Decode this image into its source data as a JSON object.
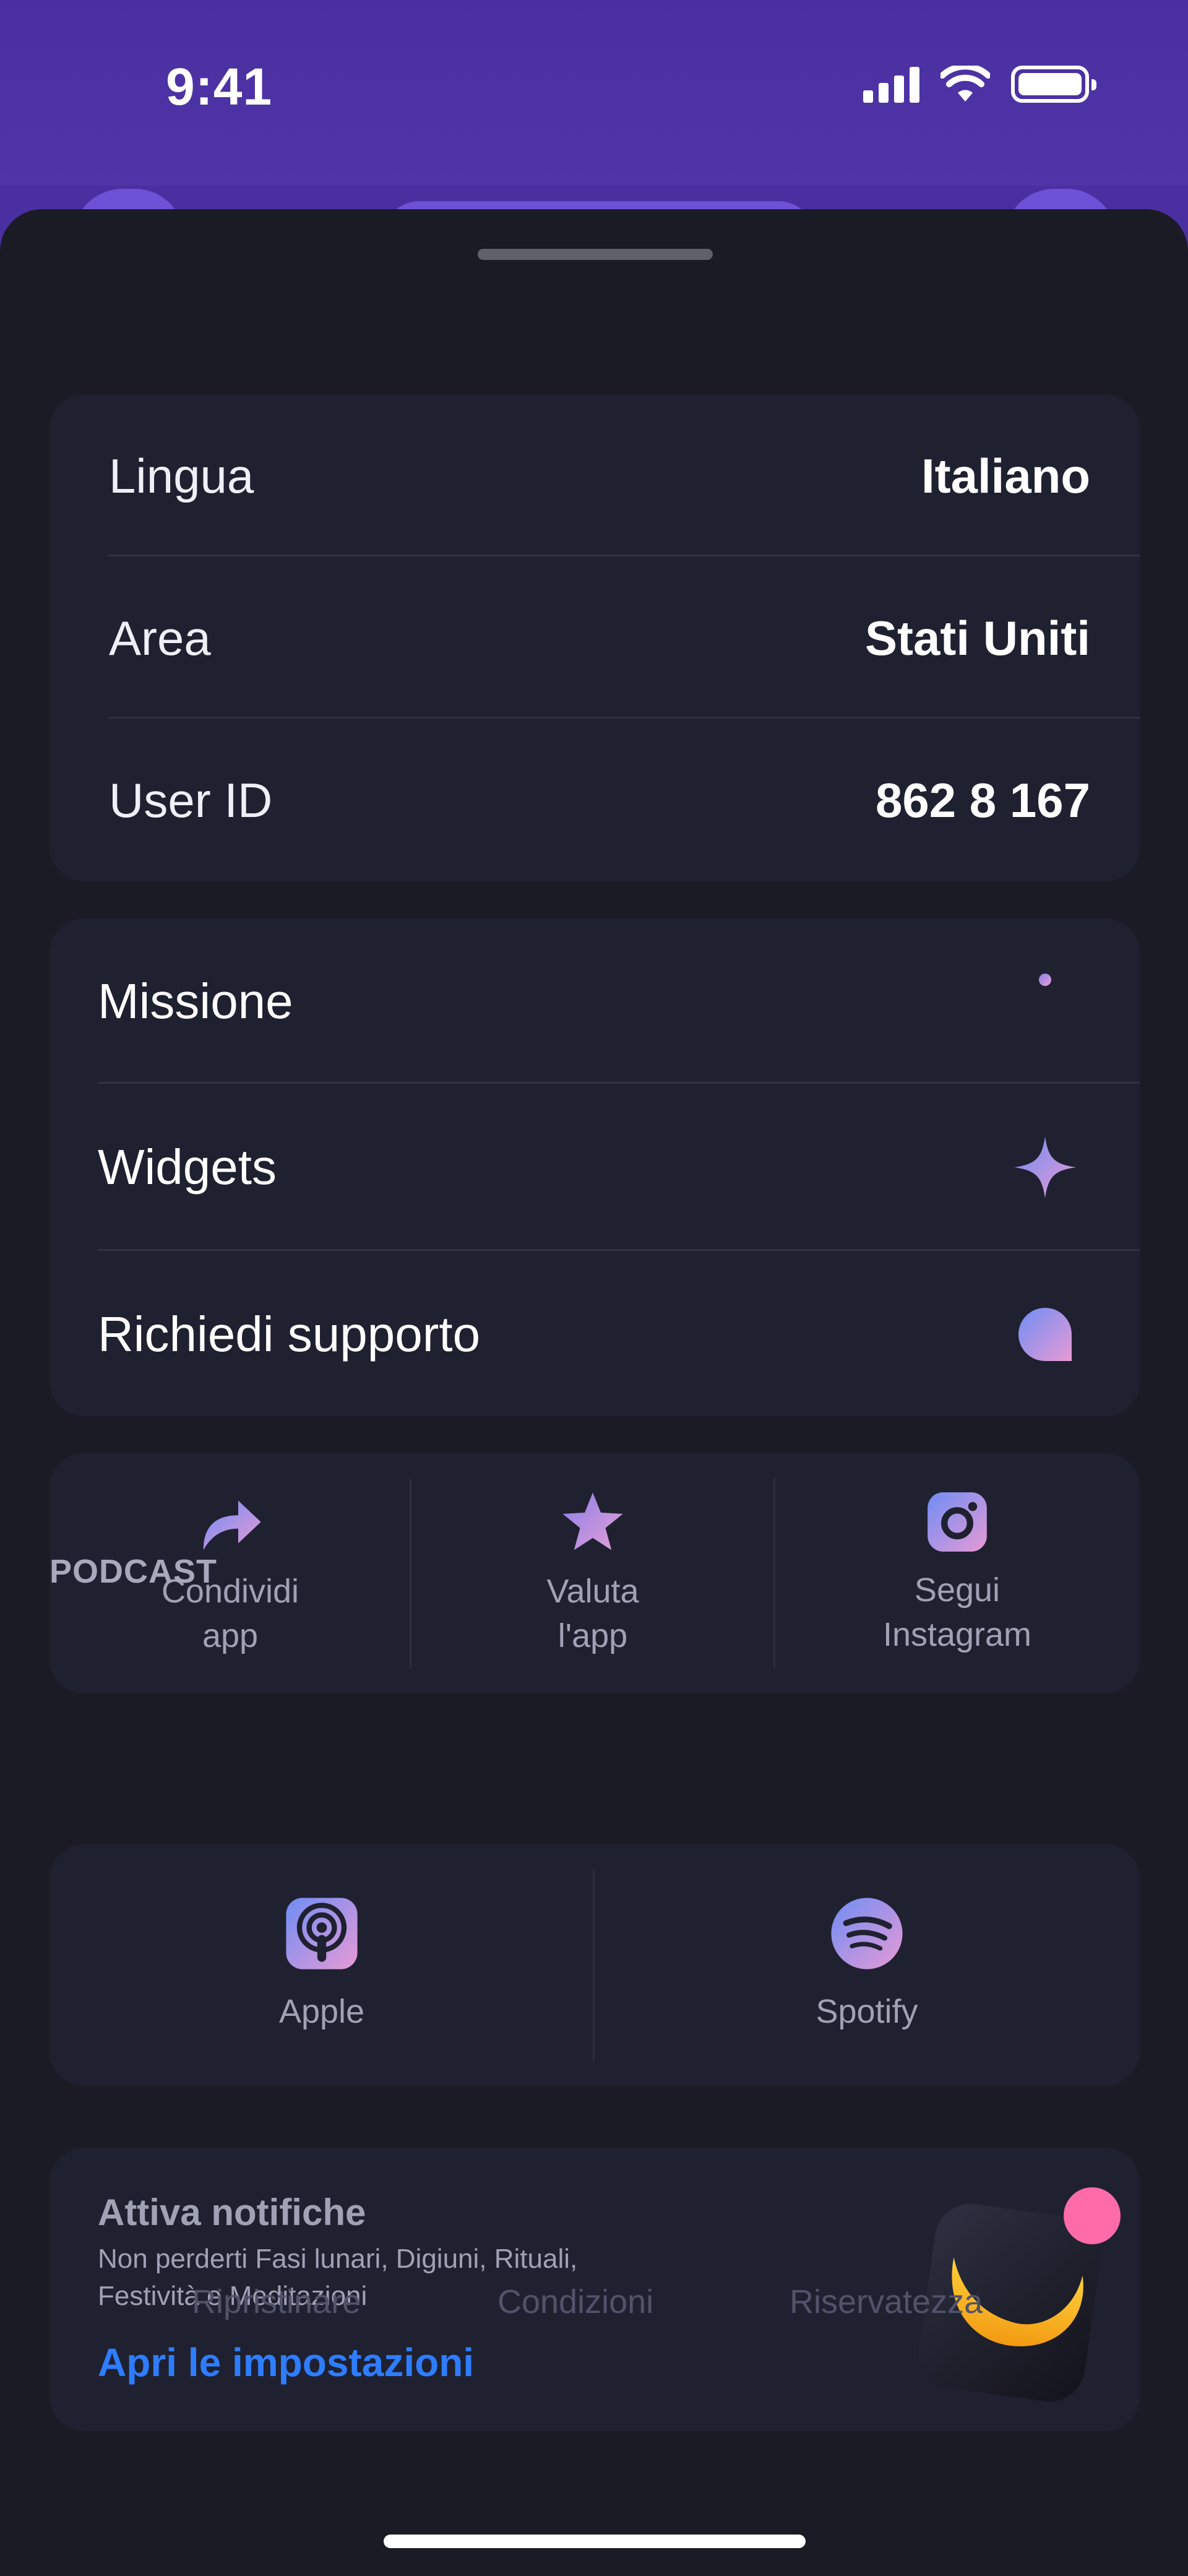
{
  "status_bar": {
    "time": "9:41",
    "signal_icon": "cellular-signal-icon",
    "wifi_icon": "wifi-icon",
    "battery_icon": "battery-icon"
  },
  "settings": {
    "rows": [
      {
        "label": "Lingua",
        "value": "Italiano"
      },
      {
        "label": "Area",
        "value": "Stati Uniti"
      },
      {
        "label": "User ID",
        "value": "862 8 167"
      }
    ]
  },
  "menu": {
    "items": [
      {
        "label": "Missione",
        "icon": "crescent-moon-icon"
      },
      {
        "label": "Widgets",
        "icon": "sparkle-icon"
      },
      {
        "label": "Richiedi supporto",
        "icon": "chat-bubble-icon"
      }
    ]
  },
  "actions": {
    "items": [
      {
        "line1": "Condividi",
        "line2": "app",
        "icon": "share-arrow-icon"
      },
      {
        "line1": "Valuta",
        "line2": "l'app",
        "icon": "star-icon"
      },
      {
        "line1": "Segui",
        "line2": "Instagram",
        "icon": "instagram-icon"
      }
    ]
  },
  "podcast": {
    "section_label": "PODCAST",
    "items": [
      {
        "label": "Apple",
        "icon": "apple-podcasts-icon"
      },
      {
        "label": "Spotify",
        "icon": "spotify-icon"
      }
    ]
  },
  "notifications": {
    "title": "Attiva notifiche",
    "description": "Non perderti Fasi lunari, Digiuni, Rituali, Festività e Meditazioni",
    "link": "Apri le impostazioni",
    "illustration": "moon-app-badge-icon"
  },
  "footer": {
    "restore": "Ripristinare",
    "terms": "Condizioni",
    "privacy": "Riservatezza"
  },
  "colors": {
    "accent_gradient_start": "#6f8df5",
    "accent_gradient_end": "#e79ad5",
    "link": "#2e7dff",
    "sheet_bg": "#1a1b25",
    "card_bg": "#1f2130",
    "header_bg": "#4a2fa0"
  }
}
